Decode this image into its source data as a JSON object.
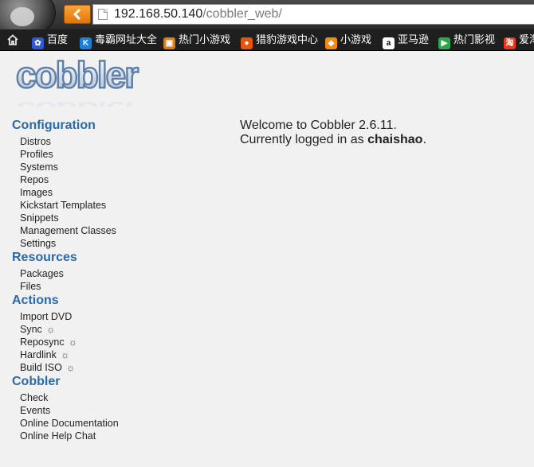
{
  "browser": {
    "url_host": "192.168.50.140",
    "url_path": "/cobbler_web/",
    "bookmarks": [
      {
        "label": "百度",
        "icon": "baidu-paw-icon",
        "color": "#2f58d6"
      },
      {
        "label": "毒霸网址大全",
        "icon": "duba-k-icon",
        "color": "#1a7fd8"
      },
      {
        "label": "热门小游戏",
        "icon": "games-bag-icon",
        "color": "#e07a14"
      },
      {
        "label": "猎豹游戏中心",
        "icon": "liebao-game-icon",
        "color": "#e8530e"
      },
      {
        "label": "小游戏",
        "icon": "small-game-icon",
        "color": "#f28a14"
      },
      {
        "label": "亚马逊",
        "icon": "amazon-a-icon",
        "color": "#ffffff"
      },
      {
        "label": "热门影视",
        "icon": "video-play-icon",
        "color": "#2aa84a"
      },
      {
        "label": "爱淘",
        "icon": "taobao-tao-icon",
        "color": "#e83a1a"
      }
    ]
  },
  "logo": {
    "text": "cobbler"
  },
  "welcome": {
    "line1": "Welcome to Cobbler 2.6.11.",
    "line2_prefix": "Currently logged in as ",
    "username": "chaishao",
    "line2_suffix": "."
  },
  "nav": [
    {
      "heading": "Configuration",
      "items": [
        {
          "label": "Distros"
        },
        {
          "label": "Profiles"
        },
        {
          "label": "Systems"
        },
        {
          "label": "Repos"
        },
        {
          "label": "Images"
        },
        {
          "label": "Kickstart Templates"
        },
        {
          "label": "Snippets"
        },
        {
          "label": "Management Classes"
        },
        {
          "label": "Settings"
        }
      ]
    },
    {
      "heading": "Resources",
      "items": [
        {
          "label": "Packages"
        },
        {
          "label": "Files"
        }
      ]
    },
    {
      "heading": "Actions",
      "items": [
        {
          "label": "Import DVD",
          "spinner": false
        },
        {
          "label": "Sync",
          "spinner": true
        },
        {
          "label": "Reposync",
          "spinner": true
        },
        {
          "label": "Hardlink",
          "spinner": true
        },
        {
          "label": "Build ISO",
          "spinner": true
        }
      ]
    },
    {
      "heading": "Cobbler",
      "items": [
        {
          "label": "Check"
        },
        {
          "label": "Events"
        },
        {
          "label": "Online Documentation"
        },
        {
          "label": "Online Help Chat"
        }
      ]
    }
  ]
}
